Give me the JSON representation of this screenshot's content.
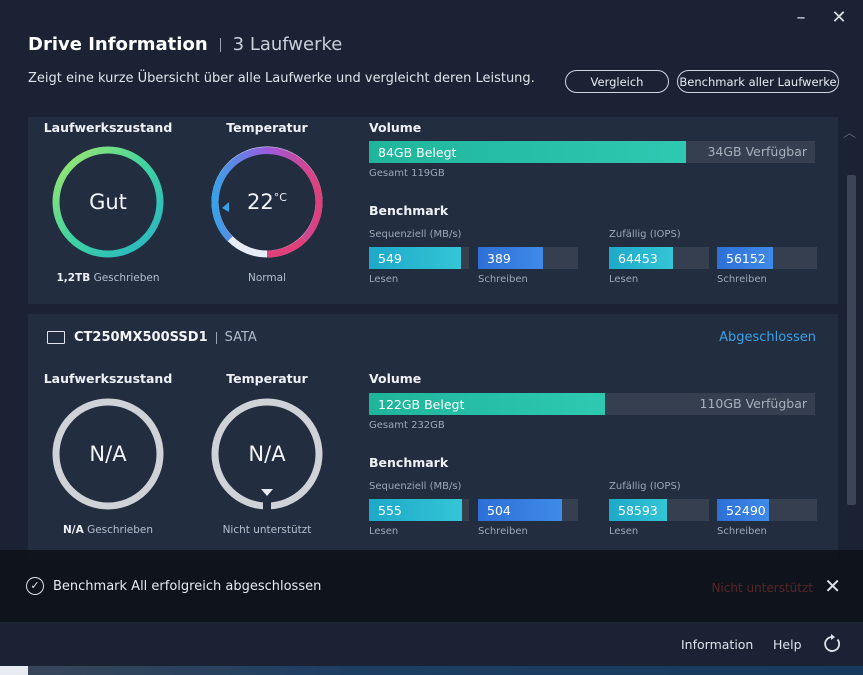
{
  "window": {
    "minimize": "–",
    "close": "✕"
  },
  "header": {
    "title": "Drive Information",
    "subtitle": "3 Laufwerke",
    "description": "Zeigt eine kurze Übersicht über alle Laufwerke und vergleicht deren Leistung.",
    "compare_button": "Vergleich",
    "benchmark_all_button": "Benchmark aller Laufwerke"
  },
  "labels": {
    "health": "Laufwerkszustand",
    "temperature": "Temperatur",
    "volume": "Volume",
    "benchmark": "Benchmark",
    "sequential": "Sequenziell (MB/s)",
    "random": "Zufällig (IOPS)",
    "read": "Lesen",
    "write": "Schreiben",
    "written_suffix": "Geschrieben"
  },
  "drives": [
    {
      "health_text": "Gut",
      "written": "1,2TB",
      "temperature": "22",
      "temp_unit": "°C",
      "temp_status": "Normal",
      "vol_used": "84GB Belegt",
      "vol_free": "34GB Verfügbar",
      "vol_used_fraction": 0.71,
      "vol_total": "Gesamt 119GB",
      "seq_read": "549",
      "seq_write": "389",
      "rand_read": "64453",
      "rand_write": "56152",
      "seq_read_frac": 0.92,
      "seq_write_frac": 0.65,
      "rand_read_frac": 0.64,
      "rand_write_frac": 0.56
    },
    {
      "name": "CT250MX500SSD1",
      "bus": "SATA",
      "status": "Abgeschlossen",
      "health_text": "N/A",
      "written": "N/A",
      "temperature": "N/A",
      "temp_status": "Nicht unterstützt",
      "vol_used": "122GB Belegt",
      "vol_free": "110GB Verfügbar",
      "vol_used_fraction": 0.53,
      "vol_total": "Gesamt 232GB",
      "seq_read": "555",
      "seq_write": "504",
      "rand_read": "58593",
      "rand_write": "52490",
      "seq_read_frac": 0.93,
      "seq_write_frac": 0.84,
      "rand_read_frac": 0.58,
      "rand_write_frac": 0.52
    }
  ],
  "toast": {
    "message": "Benchmark All erfolgreich abgeschlossen",
    "ghost_text": "Nicht unterstützt"
  },
  "footer": {
    "information": "Information",
    "help": "Help"
  },
  "colors": {
    "accent_blue": "#3aa3e8",
    "volume_green": "#1fb59b",
    "bench_cyan": "#1fa8c9",
    "bench_blue": "#2d6fd6"
  },
  "icons": {
    "drive": "drive-icon",
    "check": "check-circle-icon",
    "refresh": "refresh-icon",
    "close": "close-icon"
  }
}
